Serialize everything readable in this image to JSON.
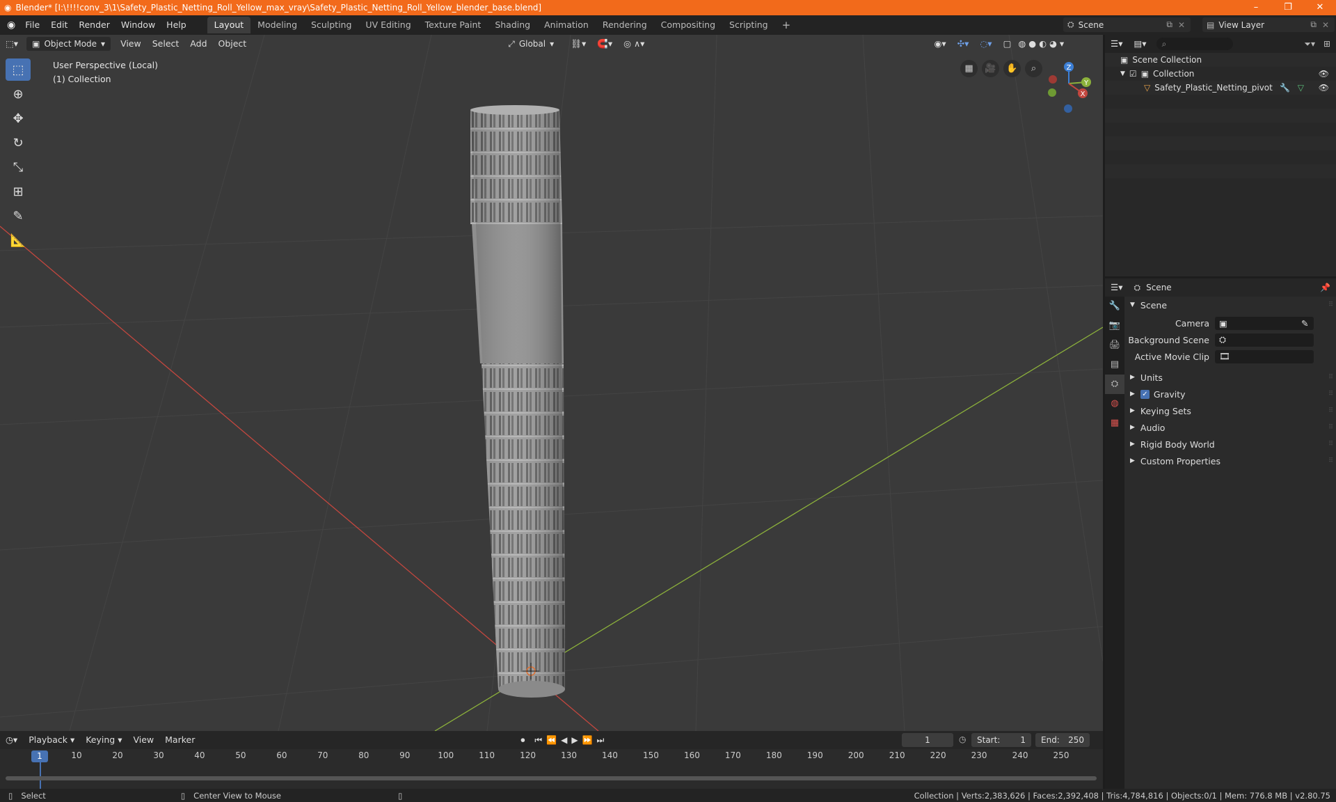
{
  "window": {
    "title": "Blender* [I:\\!!!!conv_3\\1\\Safety_Plastic_Netting_Roll_Yellow_max_vray\\Safety_Plastic_Netting_Roll_Yellow_blender_base.blend]",
    "controls": [
      "–",
      "❐",
      "✕"
    ]
  },
  "menu": [
    "File",
    "Edit",
    "Render",
    "Window",
    "Help"
  ],
  "workspaces": [
    "Layout",
    "Modeling",
    "Sculpting",
    "UV Editing",
    "Texture Paint",
    "Shading",
    "Animation",
    "Rendering",
    "Compositing",
    "Scripting"
  ],
  "active_workspace": "Layout",
  "scene_selector": "Scene",
  "view_layer_selector": "View Layer",
  "viewport": {
    "mode": "Object Mode",
    "menus": [
      "View",
      "Select",
      "Add",
      "Object"
    ],
    "orientation": "Global",
    "info_line1": "User Perspective (Local)",
    "info_line2": "(1) Collection",
    "gizmo_labels": [
      "Z",
      "Y",
      "X"
    ],
    "colors": {
      "x_axis": "#c3473f",
      "y_axis": "#8cb13b",
      "z_axis": "#3c7fd6",
      "bg": "#3a3a3a",
      "accent": "#4772b3"
    }
  },
  "outliner": {
    "items": [
      {
        "label": "Scene Collection"
      },
      {
        "label": "Collection"
      },
      {
        "label": "Safety_Plastic_Netting_pivot"
      }
    ]
  },
  "properties": {
    "header": "Scene",
    "panel": "Scene",
    "fields": [
      {
        "label": "Camera"
      },
      {
        "label": "Background Scene"
      },
      {
        "label": "Active Movie Clip"
      }
    ],
    "sections": [
      "Units",
      "Gravity",
      "Keying Sets",
      "Audio",
      "Rigid Body World",
      "Custom Properties"
    ],
    "gravity_checked": true
  },
  "timeline": {
    "menus": [
      "Playback",
      "Keying",
      "View",
      "Marker"
    ],
    "current_frame": "1",
    "start_label": "Start:",
    "start": "1",
    "end_label": "End:",
    "end": "250",
    "ticks": [
      "1",
      "10",
      "20",
      "30",
      "40",
      "50",
      "60",
      "70",
      "80",
      "90",
      "100",
      "110",
      "120",
      "130",
      "140",
      "150",
      "160",
      "170",
      "180",
      "190",
      "200",
      "210",
      "220",
      "230",
      "240",
      "250"
    ]
  },
  "statusbar": {
    "select": "Select",
    "center": "Center View to Mouse",
    "stats": "Collection | Verts:2,383,626 | Faces:2,392,408 | Tris:4,784,816 | Objects:0/1 | Mem: 776.8 MB | v2.80.75"
  }
}
